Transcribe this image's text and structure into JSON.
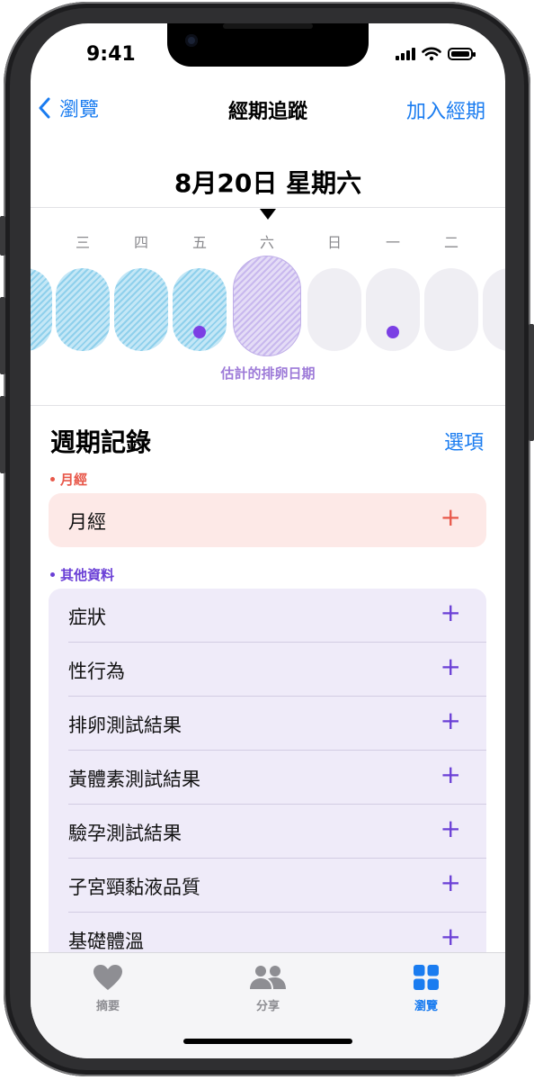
{
  "status_bar": {
    "time": "9:41"
  },
  "nav": {
    "back_label": "瀏覽",
    "title": "經期追蹤",
    "action_label": "加入經期"
  },
  "date_header": "8月20日 星期六",
  "calendar": {
    "weekdays": [
      "三",
      "四",
      "五",
      "六",
      "日",
      "一",
      "二"
    ],
    "ovulation_label": "估計的排卵日期"
  },
  "cycle_log": {
    "title": "週期記錄",
    "options_label": "選項",
    "period_section": {
      "label": "月經",
      "color": "#e8584a",
      "items": [
        {
          "label": "月經"
        }
      ],
      "card_bg": "#fde9e7"
    },
    "other_section": {
      "label": "其他資料",
      "color": "#6a3fd6",
      "card_bg": "#efebf9",
      "items": [
        {
          "label": "症狀"
        },
        {
          "label": "性行為"
        },
        {
          "label": "排卵測試結果"
        },
        {
          "label": "黃體素測試結果"
        },
        {
          "label": "驗孕測試結果"
        },
        {
          "label": "子宮頸黏液品質"
        },
        {
          "label": "基礎體溫"
        }
      ]
    }
  },
  "tab_bar": {
    "tabs": [
      {
        "label": "摘要",
        "icon": "heart-icon",
        "selected": false
      },
      {
        "label": "分享",
        "icon": "people-icon",
        "selected": false
      },
      {
        "label": "瀏覽",
        "icon": "grid-icon",
        "selected": true
      }
    ],
    "accent": "#1a7cf0",
    "inactive": "#8e8e93"
  },
  "colors": {
    "link": "#1a7cf0",
    "plus_period": "#e8584a",
    "plus_other": "#6a3fd6"
  }
}
